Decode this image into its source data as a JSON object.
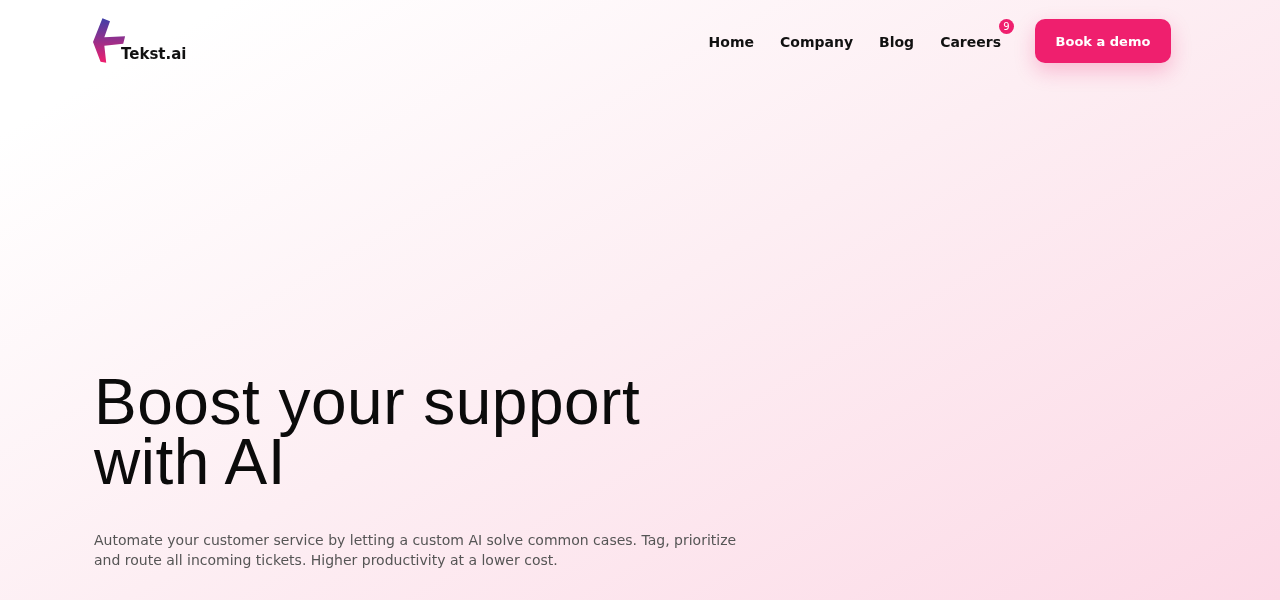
{
  "logo": {
    "text": "Tekst.ai"
  },
  "nav": [
    {
      "label": "Home"
    },
    {
      "label": "Company"
    },
    {
      "label": "Blog"
    },
    {
      "label": "Careers",
      "badge": "9"
    }
  ],
  "cta": {
    "label": "Book a demo"
  },
  "hero": {
    "title_lines": [
      "Boost your support",
      "with AI"
    ],
    "subtitle": "Automate your customer service by letting a custom AI solve common cases. Tag, prioritize and route all incoming tickets. Higher productivity at a lower cost."
  }
}
